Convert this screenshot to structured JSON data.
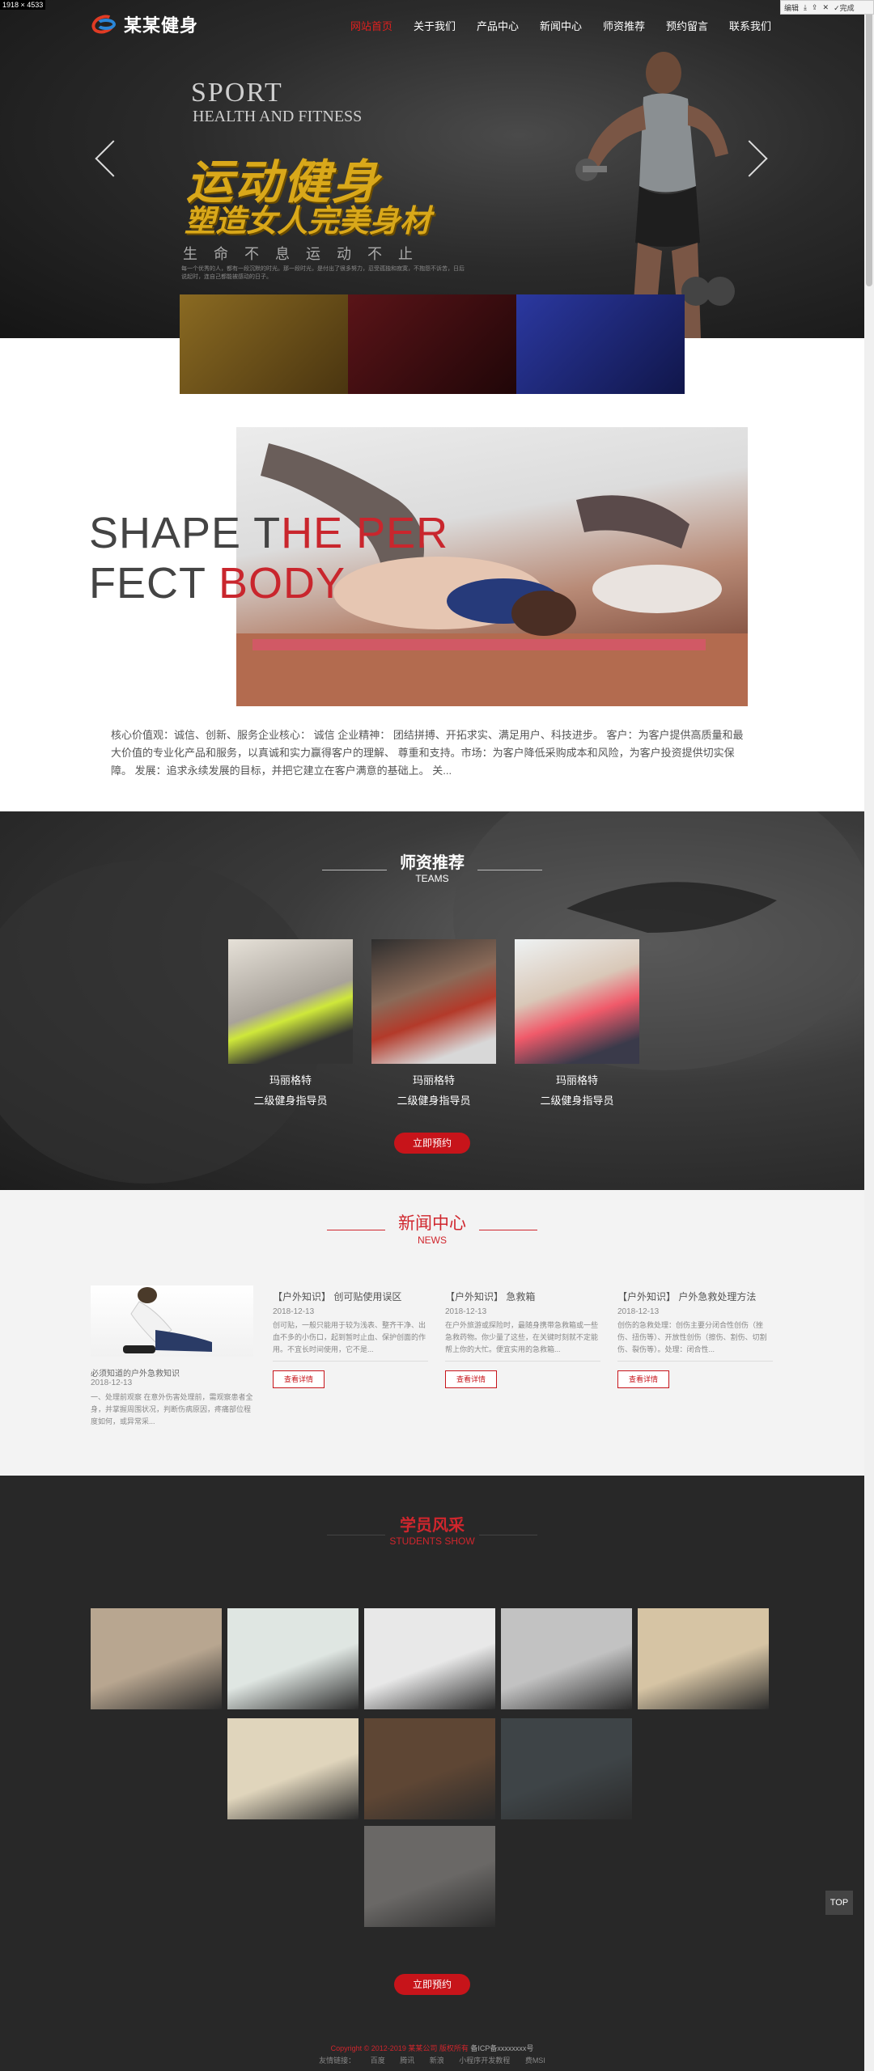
{
  "screenshot": {
    "meta": "1918 × 4533",
    "toolbar": [
      "编辑",
      "下载",
      "分享",
      "关闭",
      "完成"
    ]
  },
  "header": {
    "logo_text": "某某健身",
    "nav": [
      "网站首页",
      "关于我们",
      "产品中心",
      "新闻中心",
      "师资推荐",
      "预约留言",
      "联系我们"
    ],
    "active_nav": "网站首页"
  },
  "hero": {
    "sport": "SPORT",
    "health": "HEALTH AND FITNESS",
    "title1": "运动健身",
    "title2": "塑造女人完美身材",
    "subtitle": "生命不息运动不止",
    "desc": "每一个优秀的人，都有一段沉默的时光。那一段时光，是付出了很多努力，忍受孤独和寂寞，不抱怨不诉苦，日后说起时，连自己都能被感动的日子。",
    "thumb_colors": [
      "#6b4f12",
      "#3a0f12",
      "#1f2a7a"
    ]
  },
  "about": {
    "heading_line1_dark": "SHAPE T",
    "heading_line1_red": "HE PER",
    "heading_line2_dark": "FECT ",
    "heading_line2_red": "BODY",
    "text": "核心价值观：诚信、创新、服务企业核心： 诚信 企业精神： 团结拼搏、开拓求实、满足用户、科技进步。 客户：为客户提供高质量和最大价值的专业化产品和服务，以真诚和实力赢得客户的理解、 尊重和支持。市场：为客户降低采购成本和风险，为客户投资提供切实保障。 发展：追求永续发展的目标，并把它建立在客户满意的基础上。 关..."
  },
  "teams": {
    "title": "师资推荐",
    "subtitle": "TEAMS",
    "teachers": [
      {
        "name": "玛丽格特",
        "role": "二级健身指导员"
      },
      {
        "name": "玛丽格特",
        "role": "二级健身指导员"
      },
      {
        "name": "玛丽格特",
        "role": "二级健身指导员"
      }
    ],
    "button": "立即预约"
  },
  "news": {
    "title": "新闻中心",
    "subtitle": "NEWS",
    "feature": {
      "title": "必须知道的户外急救知识",
      "date": "2018-12-13",
      "text": "一、处理前观察 在意外伤害处理前，需观察患者全身，并掌握周围状况，判断伤病原因，疼痛部位程度如何，或异常采..."
    },
    "items": [
      {
        "title": "【户外知识】 创可贴使用误区",
        "date": "2018-12-13",
        "text": "创可贴，一般只能用于较为浅表、整齐干净、出血不多的小伤口，起到暂时止血、保护创面的作用。不宜长时间使用，它不是...",
        "more": "查看详情"
      },
      {
        "title": "【户外知识】 急救箱",
        "date": "2018-12-13",
        "text": "在户外旅游或探险时，最随身携带急救箱或一些急救药物。你少量了这些，在关键时刻就不定能帮上你的大忙。便宜实用的急救箱...",
        "more": "查看详情"
      },
      {
        "title": "【户外知识】 户外急救处理方法",
        "date": "2018-12-13",
        "text": "创伤的急救处理：创伤主要分闭合性创伤（挫伤、扭伤等）、开放性创伤（擦伤、割伤、切割伤、裂伤等）。处理：闭合性...",
        "more": "查看详情"
      }
    ]
  },
  "students": {
    "title": "学员风采",
    "subtitle": "STUDENTS SHOW",
    "photo_colors": [
      "#b8a690",
      "#dfe6e2",
      "#e8e8e8",
      "#c2c2c2",
      "#d6c4a4",
      "#e0d5bc",
      "#5e4634",
      "#3e4447",
      "#6a6866"
    ],
    "button": "立即预约"
  },
  "back_to_top": "TOP",
  "footer": {
    "copyright": "Copyright © 2012-2019 某某公司 版权所有 ",
    "icp": "备ICP备xxxxxxxx号",
    "links_label": "友情链接：",
    "links": [
      "百度",
      "腾讯",
      "新浪",
      "小程序开发教程",
      "费MSI"
    ]
  }
}
